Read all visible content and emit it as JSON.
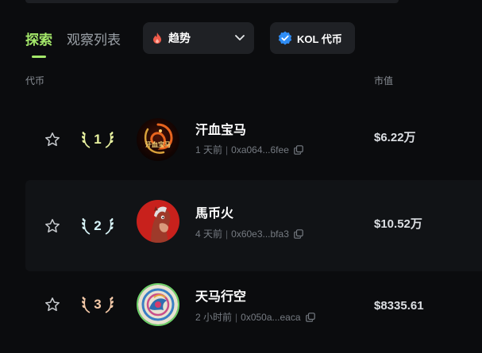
{
  "tabs": [
    {
      "label": "探索",
      "active": true
    },
    {
      "label": "观察列表",
      "active": false
    }
  ],
  "filter": {
    "selected": "趋势",
    "icon": "flame-icon"
  },
  "kol": {
    "label": "KOL 代币",
    "icon": "verified-badge-icon"
  },
  "columns": {
    "token": "代币",
    "market_cap": "市值"
  },
  "accent_color": "#a4e86a",
  "tokens": [
    {
      "rank": "1",
      "name": "汗血宝马",
      "age": "1 天前",
      "address": "0xa064...6fee",
      "market_cap": "$6.22万",
      "avatar_text": "汗血宝马",
      "laurel_color": "#e9f3a0"
    },
    {
      "rank": "2",
      "name": "馬币火",
      "age": "4 天前",
      "address": "0x60e3...bfa3",
      "market_cap": "$10.52万",
      "laurel_color": "#d7f3f7"
    },
    {
      "rank": "3",
      "name": "天马行空",
      "age": "2 小时前",
      "address": "0x050a...eaca",
      "market_cap": "$8335.61",
      "laurel_color": "#f4c9a8"
    }
  ]
}
